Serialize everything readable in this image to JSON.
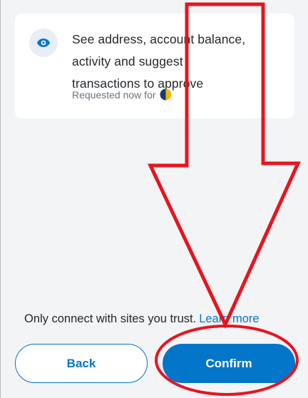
{
  "permission": {
    "icon": "eye-icon",
    "line1": "See address, account balance,",
    "line2": "activity and suggest",
    "line3": "transactions to approve",
    "requested": "Requested now for"
  },
  "footer": {
    "trust_text": "Only connect with sites you trust.",
    "learn_more": "Learn more"
  },
  "buttons": {
    "back": "Back",
    "confirm": "Confirm"
  },
  "colors": {
    "accent": "#0376c9",
    "annotation": "#e8141f",
    "background": "#f2f4f6"
  }
}
